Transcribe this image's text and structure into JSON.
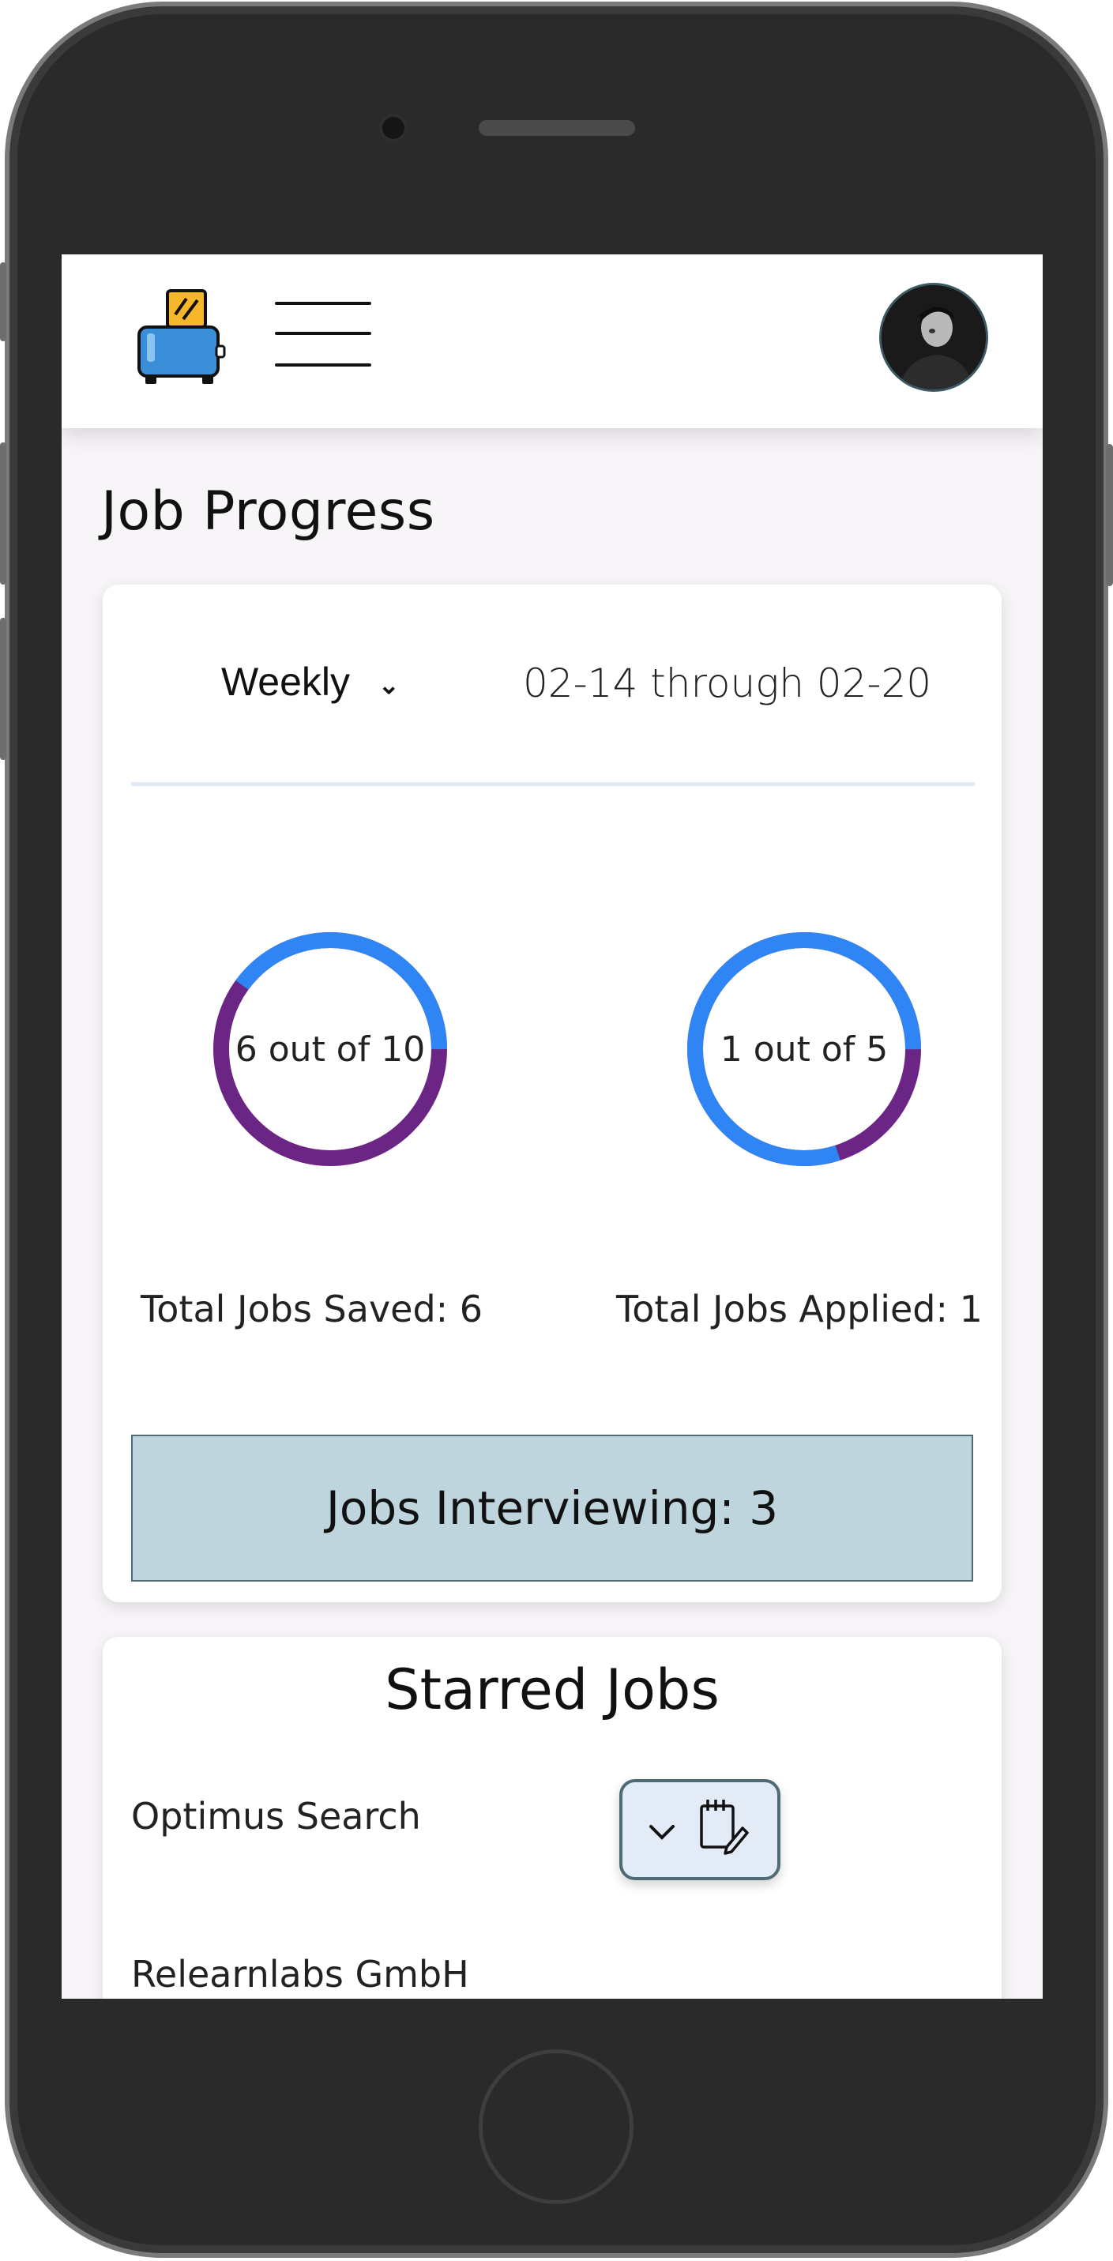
{
  "header": {
    "logo_icon": "toaster-icon",
    "menu_icon": "hamburger-icon",
    "avatar_icon": "user-avatar"
  },
  "page": {
    "title": "Job Progress"
  },
  "progress": {
    "period": {
      "selected": "Weekly",
      "icon": "chevron-down-icon"
    },
    "date_range": "02-14 through 02-20",
    "saved": {
      "ring_label": "6 out of 10",
      "value": 6,
      "total": 10,
      "stat": "Total Jobs Saved: 6"
    },
    "applied": {
      "ring_label": "1 out of 5",
      "value": 1,
      "total": 5,
      "stat": "Total Jobs Applied: 1"
    },
    "interviewing": "Jobs Interviewing: 3"
  },
  "starred": {
    "title": "Starred Jobs",
    "jobs": [
      {
        "name": "Optimus Search"
      },
      {
        "name": "Relearnlabs GmbH"
      }
    ],
    "actions": {
      "expand_icon": "chevron-down-icon",
      "edit_icon": "notepad-edit-icon"
    }
  },
  "colors": {
    "ring_filled": "#6b2585",
    "ring_remaining": "#2f85f4",
    "interview_bg": "#bfd5dd",
    "frame": "#2a2a2a"
  }
}
